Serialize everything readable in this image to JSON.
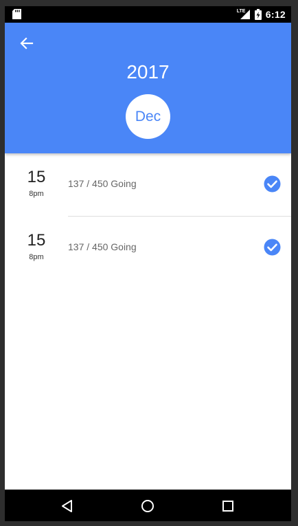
{
  "status_bar": {
    "network_label": "LTE",
    "time": "6:12"
  },
  "header": {
    "year": "2017",
    "month": "Dec",
    "background_color": "#4a86f7"
  },
  "events": [
    {
      "day": "15",
      "time": "8pm",
      "status": "137 / 450 Going",
      "checked": true
    },
    {
      "day": "15",
      "time": "8pm",
      "status": "137 / 450 Going",
      "checked": true
    }
  ],
  "icons": {
    "back": "arrow-left-icon",
    "check": "check-circle-icon",
    "nav_back": "triangle-back-icon",
    "nav_home": "circle-home-icon",
    "nav_recents": "square-recents-icon"
  }
}
